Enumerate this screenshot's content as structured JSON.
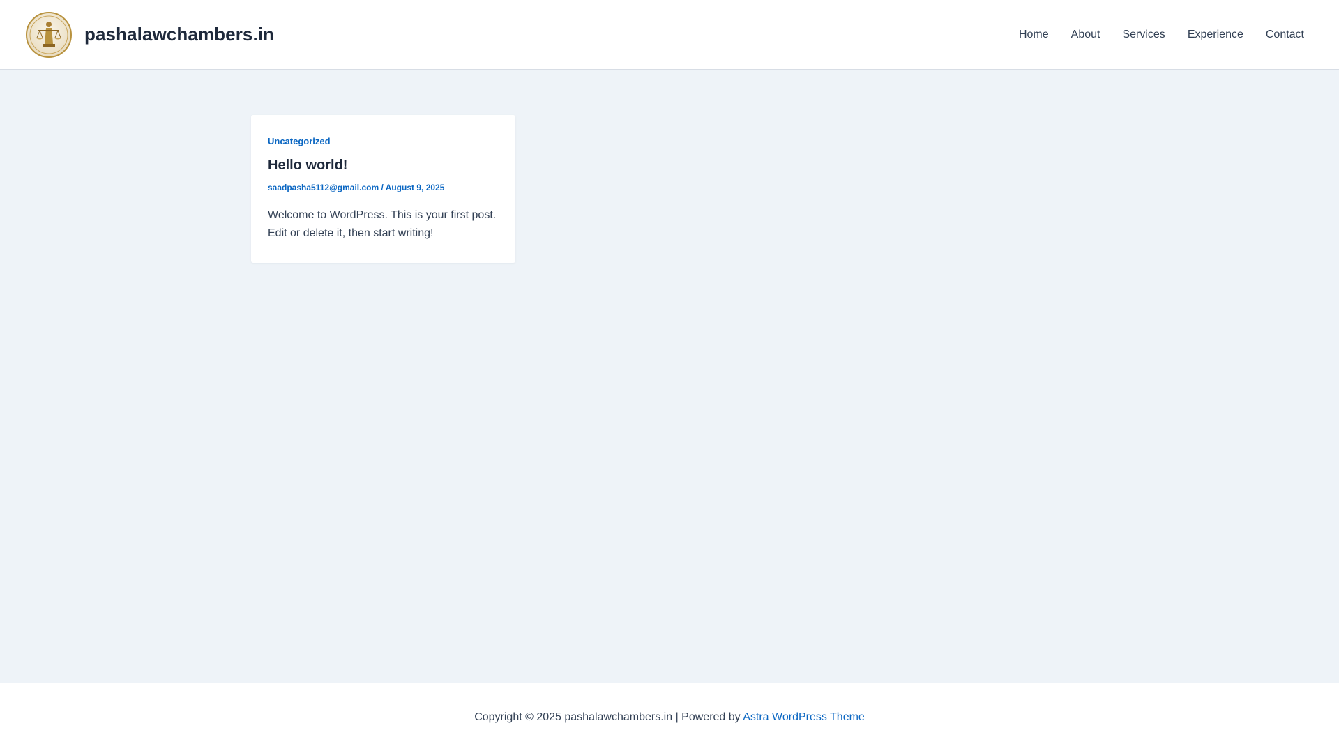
{
  "header": {
    "site_title": "pashalawchambers.in",
    "logo_icon": "scales-of-justice-logo-icon",
    "nav": [
      {
        "label": "Home"
      },
      {
        "label": "About"
      },
      {
        "label": "Services"
      },
      {
        "label": "Experience"
      },
      {
        "label": "Contact"
      }
    ]
  },
  "post": {
    "category": "Uncategorized",
    "title": "Hello world!",
    "author": "saadpasha5112@gmail.com",
    "meta_separator": " / ",
    "date": "August 9, 2025",
    "excerpt": "Welcome to WordPress. This is your first post. Edit or delete it, then start writing!"
  },
  "footer": {
    "copyright": "Copyright © 2025 pashalawchambers.in | Powered by ",
    "theme_link": "Astra WordPress Theme"
  },
  "colors": {
    "accent": "#0a66c2",
    "page_background": "#eef3f8",
    "logo_gold": "#b8923e"
  }
}
